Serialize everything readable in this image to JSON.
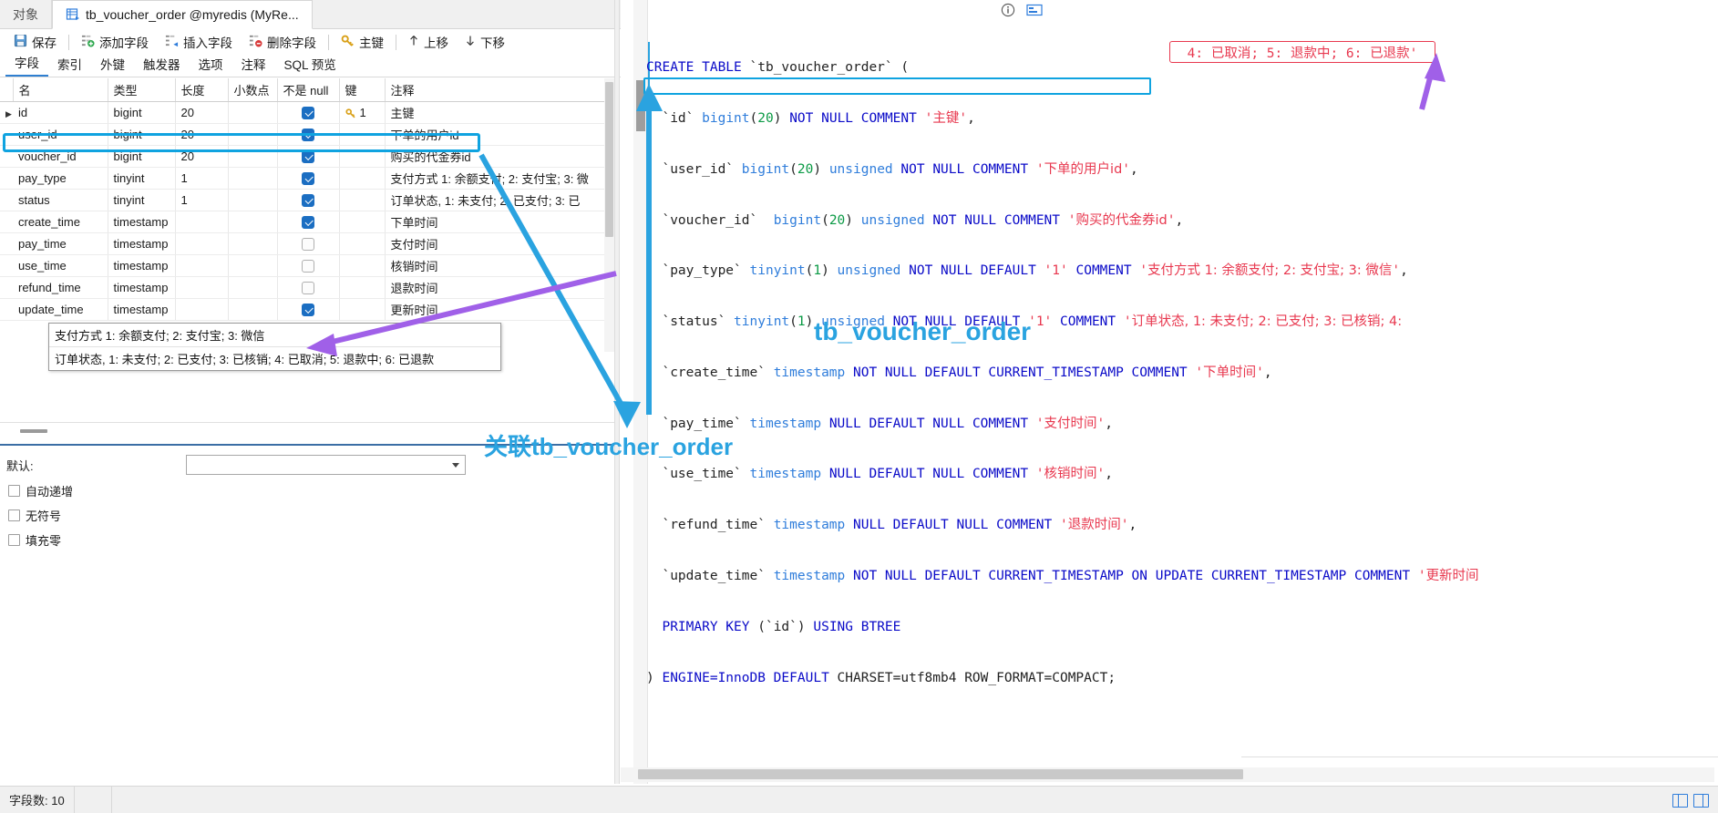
{
  "window": {
    "tabs": [
      {
        "label": "对象",
        "active": false,
        "icon": "objects-icon"
      },
      {
        "label": "tb_voucher_order @myredis (MyRe...",
        "active": true,
        "icon": "table-icon"
      }
    ]
  },
  "toolbar": {
    "buttons": [
      {
        "label": "保存",
        "icon": "save-icon"
      },
      {
        "label": "添加字段",
        "icon": "add-field-icon"
      },
      {
        "label": "插入字段",
        "icon": "insert-field-icon"
      },
      {
        "label": "删除字段",
        "icon": "delete-field-icon"
      },
      {
        "label": "主键",
        "icon": "key-icon"
      },
      {
        "label": "上移",
        "icon": "arrow-up-icon"
      },
      {
        "label": "下移",
        "icon": "arrow-down-icon"
      }
    ]
  },
  "subtabs": [
    {
      "label": "字段",
      "active": true
    },
    {
      "label": "索引",
      "active": false
    },
    {
      "label": "外键",
      "active": false
    },
    {
      "label": "触发器",
      "active": false
    },
    {
      "label": "选项",
      "active": false
    },
    {
      "label": "注释",
      "active": false
    },
    {
      "label": "SQL 预览",
      "active": false
    }
  ],
  "grid": {
    "headers": [
      "名",
      "类型",
      "长度",
      "小数点",
      "不是 null",
      "键",
      "注释"
    ],
    "rows": [
      {
        "current": true,
        "name": "id",
        "type": "bigint",
        "length": "20",
        "decimals": "",
        "notnull": true,
        "key": "1",
        "comment": "主键"
      },
      {
        "current": false,
        "name": "user_id",
        "type": "bigint",
        "length": "20",
        "decimals": "",
        "notnull": true,
        "key": "",
        "comment": "下单的用户id"
      },
      {
        "current": false,
        "name": "voucher_id",
        "type": "bigint",
        "length": "20",
        "decimals": "",
        "notnull": true,
        "key": "",
        "comment": "购买的代金券id",
        "highlighted": true
      },
      {
        "current": false,
        "name": "pay_type",
        "type": "tinyint",
        "length": "1",
        "decimals": "",
        "notnull": true,
        "key": "",
        "comment": "支付方式 1: 余额支付; 2: 支付宝; 3: 微"
      },
      {
        "current": false,
        "name": "status",
        "type": "tinyint",
        "length": "1",
        "decimals": "",
        "notnull": true,
        "key": "",
        "comment": "订单状态, 1: 未支付; 2: 已支付; 3: 已"
      },
      {
        "current": false,
        "name": "create_time",
        "type": "timestamp",
        "length": "",
        "decimals": "",
        "notnull": true,
        "key": "",
        "comment": "下单时间"
      },
      {
        "current": false,
        "name": "pay_time",
        "type": "timestamp",
        "length": "",
        "decimals": "",
        "notnull": false,
        "key": "",
        "comment": "支付时间"
      },
      {
        "current": false,
        "name": "use_time",
        "type": "timestamp",
        "length": "",
        "decimals": "",
        "notnull": false,
        "key": "",
        "comment": "核销时间"
      },
      {
        "current": false,
        "name": "refund_time",
        "type": "timestamp",
        "length": "",
        "decimals": "",
        "notnull": false,
        "key": "",
        "comment": "退款时间"
      },
      {
        "current": false,
        "name": "update_time",
        "type": "timestamp",
        "length": "",
        "decimals": "",
        "notnull": true,
        "key": "",
        "comment": "更新时间"
      }
    ]
  },
  "callout": {
    "line1": "支付方式 1: 余额支付; 2: 支付宝; 3: 微信",
    "line2": "订单状态, 1: 未支付; 2: 已支付; 3: 已核销; 4: 已取消; 5: 退款中; 6: 已退款"
  },
  "properties": {
    "default_label": "默认:",
    "default_value": "",
    "auto_increment": "自动递增",
    "unsigned": "无符号",
    "zerofill": "填充零"
  },
  "sql": {
    "line_create": "CREATE TABLE `tb_voucher_order` (",
    "line_id": "  `id` bigint(20) NOT NULL COMMENT '主键',",
    "line_user_id": "  `user_id` bigint(20) unsigned NOT NULL COMMENT '下单的用户id',",
    "line_voucher_id": "  `voucher_id` bigint(20) unsigned NOT NULL COMMENT '购买的代金券id',",
    "line_pay_type": "  `pay_type` tinyint(1) unsigned NOT NULL DEFAULT '1' COMMENT '支付方式 1: 余额支付; 2: 支付宝; 3: 微信',",
    "line_status": "  `status` tinyint(1) unsigned NOT NULL DEFAULT '1' COMMENT '订单状态, 1: 未支付; 2: 已支付; 3: 已核销; 4:",
    "line_create_time": "  `create_time` timestamp NOT NULL DEFAULT CURRENT_TIMESTAMP COMMENT '下单时间',",
    "line_pay_time": "  `pay_time` timestamp NULL DEFAULT NULL COMMENT '支付时间',",
    "line_use_time": "  `use_time` timestamp NULL DEFAULT NULL COMMENT '核销时间',",
    "line_refund_time": "  `refund_time` timestamp NULL DEFAULT NULL COMMENT '退款时间',",
    "line_update_time": "  `update_time` timestamp NOT NULL DEFAULT CURRENT_TIMESTAMP ON UPDATE CURRENT_TIMESTAMP COMMENT '更新时间",
    "line_primary": "  PRIMARY KEY (`id`) USING BTREE",
    "line_engine": ") ENGINE=InnoDB DEFAULT CHARSET=utf8mb4 ROW_FORMAT=COMPACT;"
  },
  "annotations": {
    "status_tail": "4: 已取消; 5: 退款中; 6: 已退款'",
    "table_title": "tb_voucher_order",
    "relation_label": "关联tb_voucher_order",
    "accent_blue": "#2aa3e0",
    "accent_purple": "#a060e8",
    "accent_red": "#e8384f"
  },
  "statusbar": {
    "field_count": "字段数: 10"
  }
}
